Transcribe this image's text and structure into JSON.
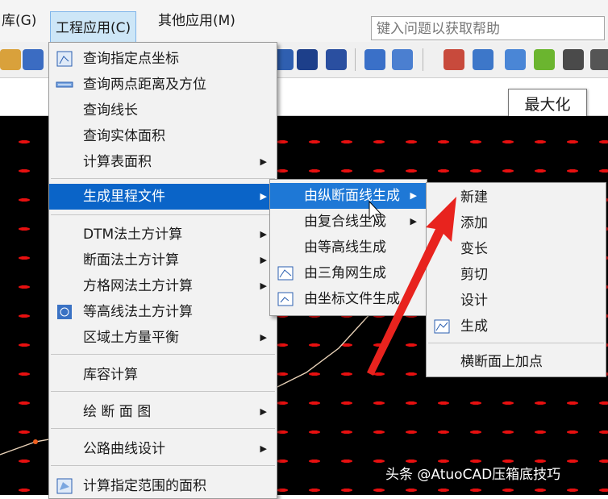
{
  "menubar": {
    "items": [
      "库(G)",
      "工程应用(C)",
      "其他应用(M)"
    ],
    "help_placeholder": "键入问题以获取帮助"
  },
  "tooltip": "最大化",
  "main_menu": {
    "items": [
      "查询指定点坐标",
      "查询两点距离及方位",
      "查询线长",
      "查询实体面积",
      "计算表面积",
      "生成里程文件",
      "DTM法土方计算",
      "断面法土方计算",
      "方格网法土方计算",
      "等高线法土方计算",
      "区域土方量平衡",
      "库容计算",
      "绘 断 面 图",
      "公路曲线设计",
      "计算指定范围的面积"
    ]
  },
  "sub_menu": {
    "items": [
      "由纵断面线生成",
      "由复合线生成",
      "由等高线生成",
      "由三角网生成",
      "由坐标文件生成"
    ]
  },
  "sub_sub_menu": {
    "items": [
      "新建",
      "添加",
      "变长",
      "剪切",
      "设计",
      "生成",
      "横断面上加点"
    ]
  },
  "watermark": "头条 @AtuoCAD压箱底技巧",
  "colors": {
    "highlight": "#0a64c8",
    "grid_dash": "#e81010",
    "arrow": "#e8231e"
  }
}
